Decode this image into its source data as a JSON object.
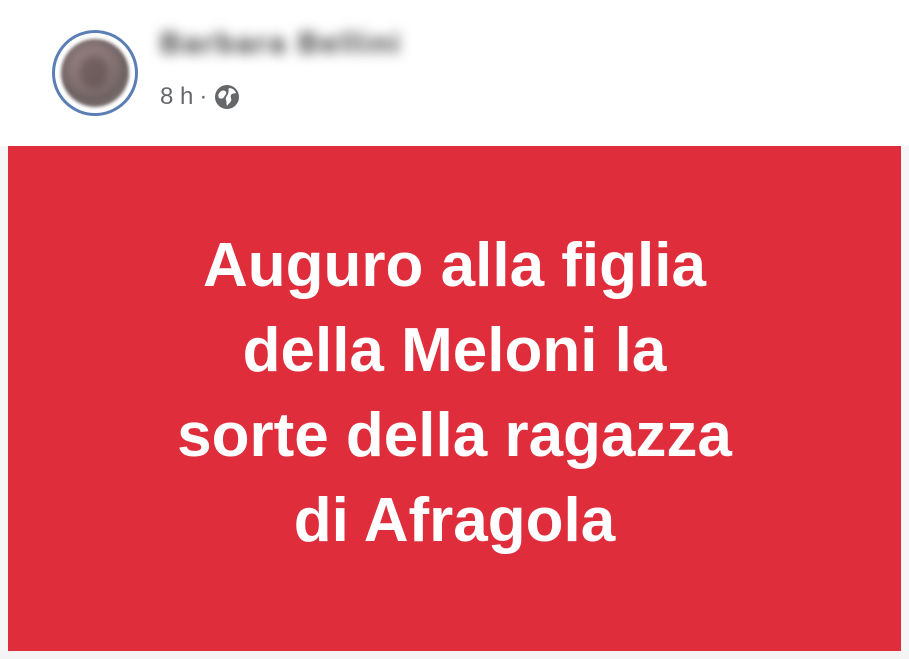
{
  "post": {
    "author_name": "Barbara Bellini",
    "timestamp": "8 h",
    "separator": "·",
    "audience_icon": "globe-icon",
    "banner": {
      "background_color": "#df2d3c",
      "text_color": "#ffffff",
      "lines": [
        "Auguro alla figlia",
        "della Meloni la",
        "sorte della ragazza",
        "di Afragola"
      ]
    }
  }
}
